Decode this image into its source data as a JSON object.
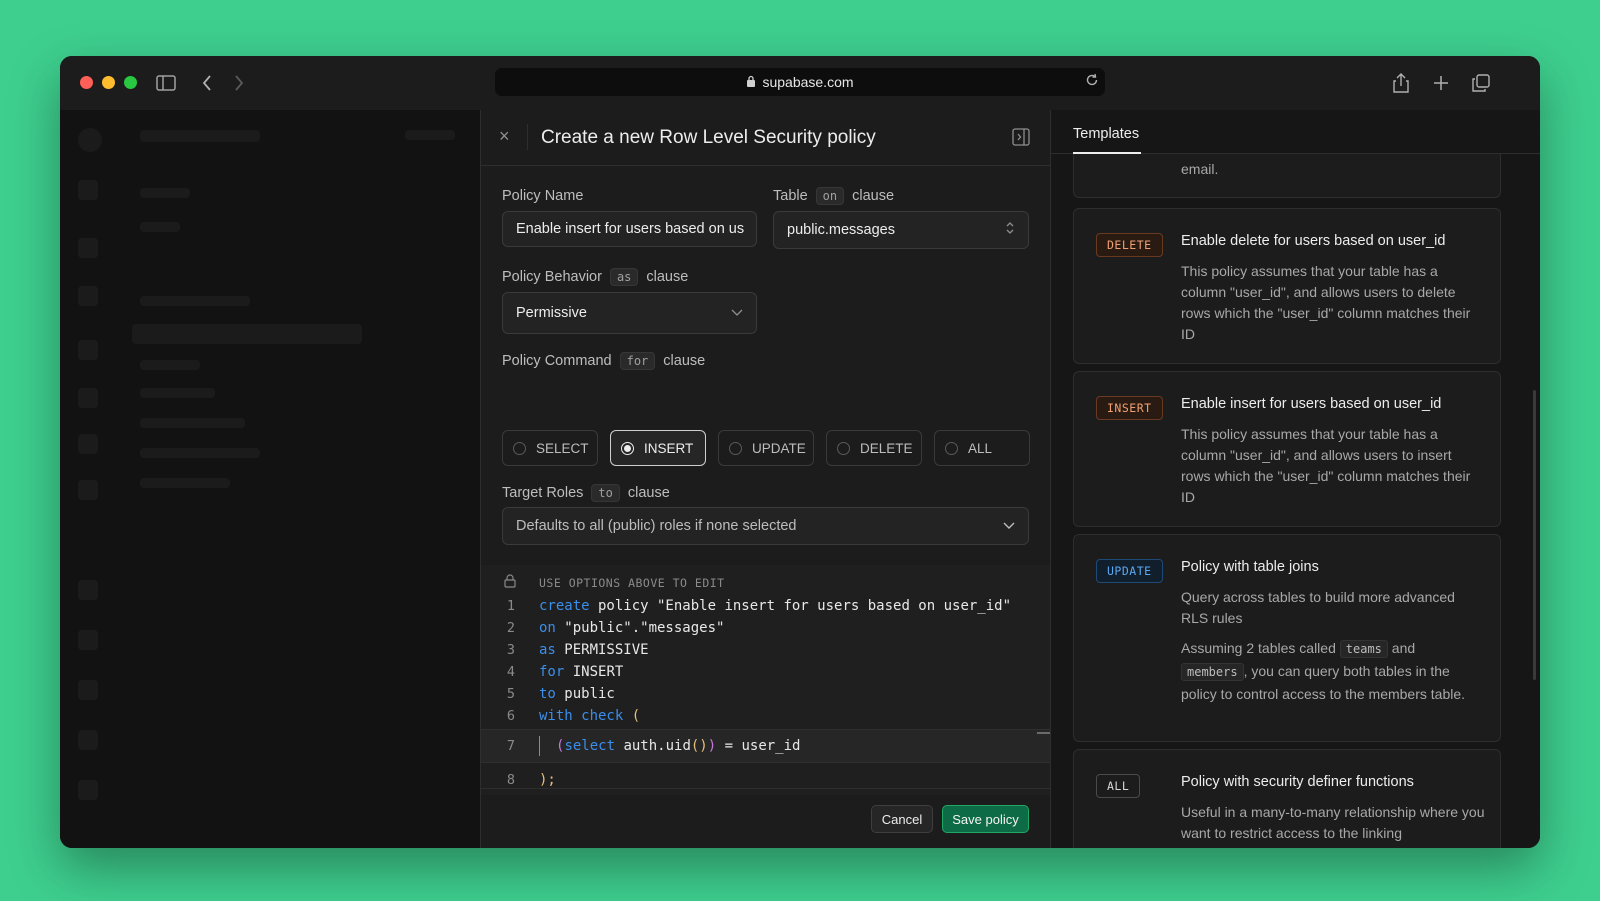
{
  "browser": {
    "url": "supabase.com"
  },
  "policy_panel": {
    "title": "Create a new Row Level Security policy",
    "policy_name": {
      "label": "Policy Name",
      "value": "Enable insert for users based on us"
    },
    "table": {
      "label": "Table",
      "clause_kw": "on",
      "clause": "clause",
      "value": "public.messages"
    },
    "behavior": {
      "label": "Policy Behavior",
      "clause_kw": "as",
      "clause": "clause",
      "value": "Permissive"
    },
    "command": {
      "label": "Policy Command",
      "clause_kw": "for",
      "clause": "clause",
      "options": [
        "SELECT",
        "INSERT",
        "UPDATE",
        "DELETE",
        "ALL"
      ],
      "selected": "INSERT"
    },
    "roles": {
      "label": "Target Roles",
      "clause_kw": "to",
      "clause": "clause",
      "placeholder": "Defaults to all (public) roles if none selected"
    },
    "editor": {
      "hint": "USE OPTIONS ABOVE TO EDIT",
      "lines": [
        {
          "n": "1",
          "kw": "create",
          "rest": " policy \"Enable insert for users based on user_id\""
        },
        {
          "n": "2",
          "kw": "on",
          "rest": " \"public\".\"messages\""
        },
        {
          "n": "3",
          "kw": "as",
          "rest": " PERMISSIVE"
        },
        {
          "n": "4",
          "kw": "for",
          "rest": " INSERT"
        },
        {
          "n": "5",
          "kw": "to",
          "rest": " public"
        },
        {
          "n": "6",
          "kw": "with check",
          "rest": " ("
        },
        {
          "n": "7",
          "kw": "select",
          "rest": "(select auth.uid()) = user_id"
        },
        {
          "n": "8",
          "kw": "",
          "rest": ");"
        }
      ]
    },
    "footer": {
      "cancel": "Cancel",
      "save": "Save policy"
    }
  },
  "templates": {
    "tab": "Templates",
    "partial_text": "email.",
    "cards": [
      {
        "badge": "DELETE",
        "title": "Enable delete for users based on user_id",
        "desc": "This policy assumes that your table has a column \"user_id\", and allows users to delete rows which the \"user_id\" column matches their ID"
      },
      {
        "badge": "INSERT",
        "title": "Enable insert for users based on user_id",
        "desc": "This policy assumes that your table has a column \"user_id\", and allows users to insert rows which the \"user_id\" column matches their ID"
      },
      {
        "badge": "UPDATE",
        "title": "Policy with table joins",
        "desc": "Query across tables to build more advanced RLS rules",
        "desc2_a": "Assuming 2 tables called",
        "chip1": "teams",
        "desc2_b": "and",
        "chip2": "members",
        "desc2_c": ", you can query both tables in the policy to control access to the members table."
      },
      {
        "badge": "ALL",
        "title": "Policy with security definer functions",
        "desc": "Useful in a many-to-many relationship where you want to restrict access to the linking"
      }
    ]
  },
  "colors": {
    "background": "#3ecf8e",
    "save_button": "#0d6b45",
    "keyword": "#3b8eea"
  }
}
